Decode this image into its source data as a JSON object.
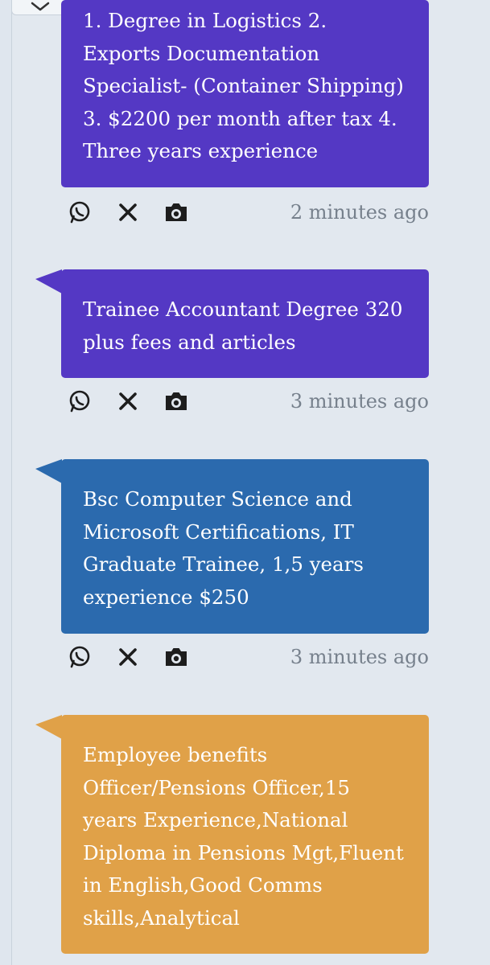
{
  "colors": {
    "purple": "#5438c4",
    "blue": "#2b6aae",
    "orange": "#e0a148",
    "background": "#e2e8ef",
    "timestamp": "#76808c"
  },
  "icons": {
    "share_whatsapp": "whatsapp-icon",
    "share_x": "x-icon",
    "screenshot": "camera-icon",
    "collapse": "chevron-down-icon"
  },
  "posts": [
    {
      "text": "1. Degree in Logistics 2. Exports Documentation Specialist- (Container Shipping) 3. $2200 per month after tax 4. Three years experience",
      "time": "2 minutes ago",
      "color": "#5438c4"
    },
    {
      "text": "Trainee Accountant Degree 320 plus fees and articles",
      "time": "3 minutes ago",
      "color": "#5438c4"
    },
    {
      "text": "Bsc Computer Science and Microsoft Certifications, IT Graduate Trainee, 1,5 years experience $250",
      "time": "3 minutes ago",
      "color": "#2b6aae"
    },
    {
      "text": "Employee benefits Officer/Pensions Officer,15 years Experience,National Diploma in Pensions Mgt,Fluent in English,Good Comms skills,Analytical",
      "time": "",
      "color": "#e0a148"
    }
  ]
}
